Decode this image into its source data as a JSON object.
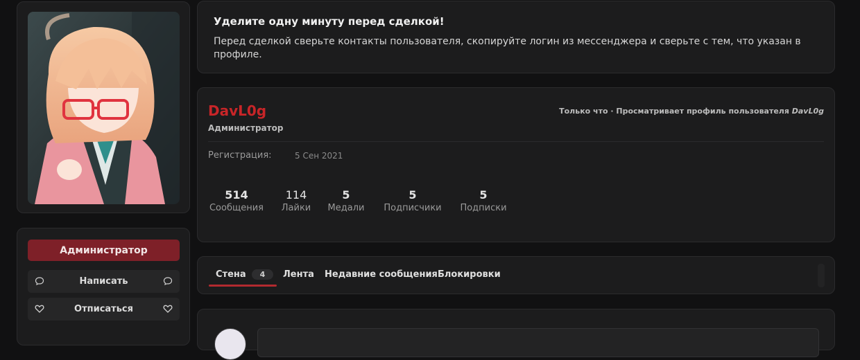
{
  "sidebar": {
    "role_badge": "Администратор",
    "actions": [
      {
        "label": "Написать",
        "icon": "chat-bubble-icon"
      },
      {
        "label": "Отписаться",
        "icon": "heart-icon"
      }
    ]
  },
  "notice": {
    "title": "Уделите одну минуту перед сделкой!",
    "text": "Перед сделкой сверьте контакты пользователя, скопируйте логин из мессенджера и сверьте с тем, что указан в профиле."
  },
  "profile": {
    "username": "DavL0g",
    "user_title": "Администратор",
    "status_prefix": "Только что · Просматривает профиль пользователя ",
    "status_user": "DavL0g",
    "registration_label": "Регистрация:",
    "registration_date": "5 Сен 2021",
    "stats": [
      {
        "value": "514",
        "label": "Сообщения"
      },
      {
        "value": "114",
        "label": "Лайки"
      },
      {
        "value": "5",
        "label": "Медали"
      },
      {
        "value": "5",
        "label": "Подписчики"
      },
      {
        "value": "5",
        "label": "Подписки"
      }
    ]
  },
  "tabs": {
    "items": [
      {
        "label": "Стена",
        "count": "4"
      },
      {
        "label": "Лента"
      },
      {
        "label": "Недавние сообщения"
      },
      {
        "label": "Блокировки"
      }
    ],
    "active": "Стена"
  },
  "colors": {
    "accent": "#c82528",
    "badge_bg": "#7e2028",
    "panel_bg": "#1c1c1d",
    "page_bg": "#111112"
  }
}
